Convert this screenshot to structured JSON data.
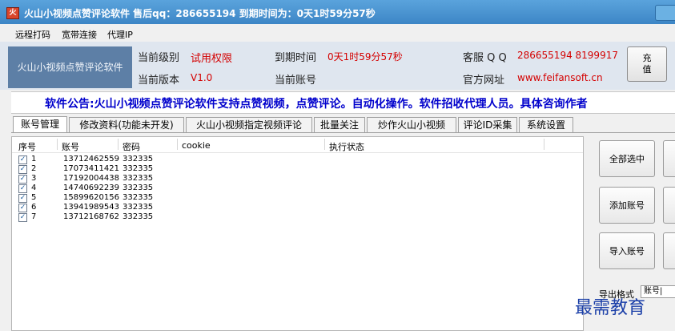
{
  "window": {
    "title": "火山小视频点赞评论软件 售后qq：286655194 到期时间为：0天1时59分57秒",
    "icon": "app-icon"
  },
  "menu": [
    "远程打码",
    "宽带连接",
    "代理IP"
  ],
  "header": {
    "brand": "火山小视频点赞评论软件",
    "level_label": "当前级别",
    "level_value": "试用权限",
    "expire_label": "到期时间",
    "expire_value": "0天1时59分57秒",
    "service_label": "客服 Q Q",
    "service_value": "286655194 8199917",
    "version_label": "当前版本",
    "version_value": "V1.0",
    "account_label": "当前账号",
    "site_label": "官方网址",
    "site_value": "www.feifansoft.cn",
    "recharge_label": "充值"
  },
  "notice": "软件公告:火山小视频点赞评论软件支持点赞视频，点赞评论。自动化操作。软件招收代理人员。具体咨询作者",
  "tabs": [
    "账号管理",
    "修改资料(功能未开发)",
    "火山小视频指定视频评论",
    "批量关注",
    "炒作火山小视频",
    "评论ID采集",
    "系统设置"
  ],
  "active_tab": "账号管理",
  "table": {
    "headers": [
      "序号",
      "账号",
      "密码",
      "cookie",
      "执行状态"
    ],
    "rows": [
      {
        "index": "1",
        "account": "13712462559",
        "password": "332335",
        "checked": true
      },
      {
        "index": "2",
        "account": "17073411421",
        "password": "332335",
        "checked": true
      },
      {
        "index": "3",
        "account": "17192004438",
        "password": "332335",
        "checked": true
      },
      {
        "index": "4",
        "account": "14740692239",
        "password": "332335",
        "checked": true
      },
      {
        "index": "5",
        "account": "15899620156",
        "password": "332335",
        "checked": true
      },
      {
        "index": "6",
        "account": "13941989543",
        "password": "332335",
        "checked": true
      },
      {
        "index": "7",
        "account": "13712168762",
        "password": "332335",
        "checked": true
      }
    ]
  },
  "side": {
    "select_all": "全部选中",
    "add_account": "添加账号",
    "import_account": "导入账号",
    "export_label": "导出格式",
    "export_value": "账号|"
  },
  "watermark": "最需教育",
  "colors": {
    "accent": "#3d86c6",
    "notice": "#0000cc",
    "value_red": "#d40000",
    "brand_bg": "#5d7fa6"
  }
}
